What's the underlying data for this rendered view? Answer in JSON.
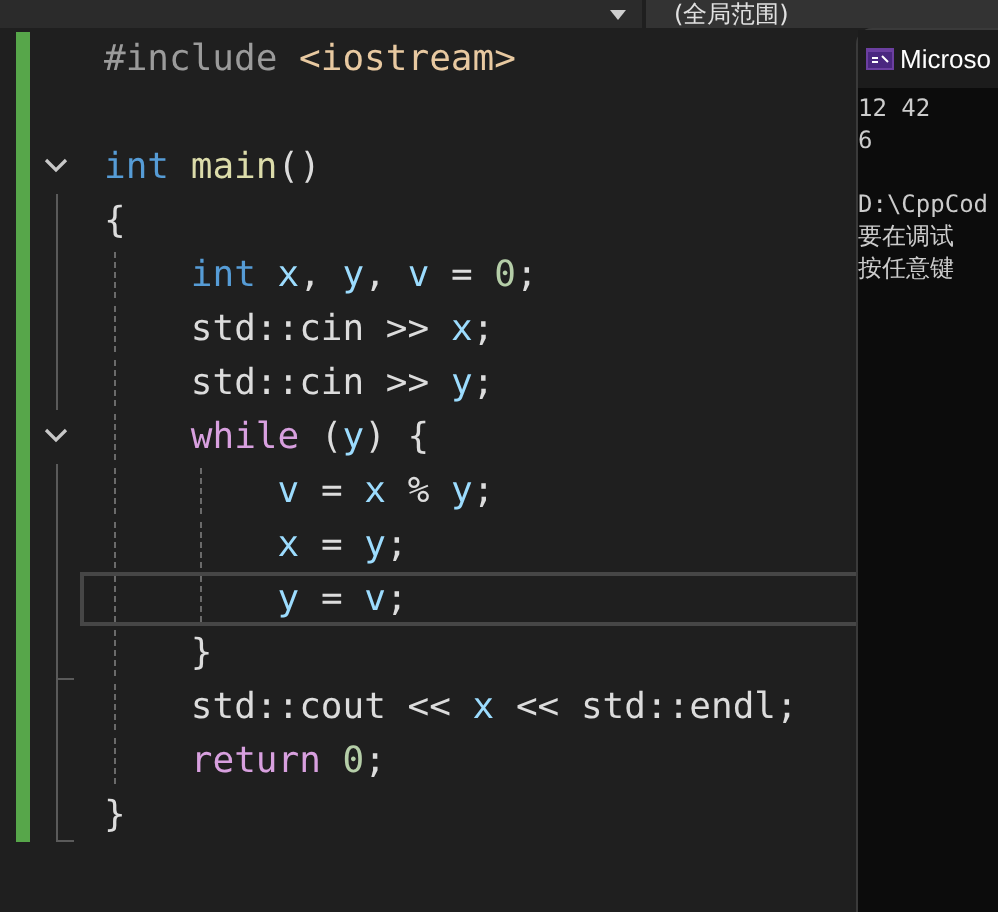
{
  "toolbar": {
    "scope": "(全局范围)"
  },
  "editor": {
    "change_bar": true,
    "lines": [
      {
        "kind": "plain",
        "tokens": [
          {
            "text": "#include ",
            "kind": "preprocessor"
          },
          {
            "text": "<iostream>",
            "kind": "string"
          }
        ]
      },
      {
        "kind": "blank"
      },
      {
        "kind": "open",
        "expanded": true,
        "tokens": [
          {
            "text": "int ",
            "kind": "keyword"
          },
          {
            "text": "main",
            "kind": "function"
          },
          {
            "text": "()",
            "kind": "punct"
          }
        ]
      },
      {
        "kind": "line",
        "tokens": [
          {
            "text": "{",
            "kind": "punct"
          }
        ],
        "children": [
          {
            "kind": "line",
            "tokens": [
              {
                "text": "int ",
                "kind": "keyword"
              },
              {
                "text": "x",
                "kind": "variable"
              },
              {
                "text": ", ",
                "kind": "punct"
              },
              {
                "text": "y",
                "kind": "variable"
              },
              {
                "text": ", ",
                "kind": "punct"
              },
              {
                "text": "v",
                "kind": "variable"
              },
              {
                "text": " = ",
                "kind": "punct"
              },
              {
                "text": "0",
                "kind": "number"
              },
              {
                "text": ";",
                "kind": "punct"
              }
            ]
          },
          {
            "kind": "line",
            "tokens": [
              {
                "text": "std::cin >> ",
                "kind": "punct"
              },
              {
                "text": "x",
                "kind": "variable"
              },
              {
                "text": ";",
                "kind": "punct"
              }
            ]
          },
          {
            "kind": "line",
            "tokens": [
              {
                "text": "std::cin >> ",
                "kind": "punct"
              },
              {
                "text": "y",
                "kind": "variable"
              },
              {
                "text": ";",
                "kind": "punct"
              }
            ]
          },
          {
            "kind": "open",
            "expanded": true,
            "tokens": [
              {
                "text": "while ",
                "kind": "control"
              },
              {
                "text": "(",
                "kind": "punct"
              },
              {
                "text": "y",
                "kind": "variable"
              },
              {
                "text": ") {",
                "kind": "punct"
              }
            ],
            "children": [
              {
                "kind": "line",
                "tokens": [
                  {
                    "text": "v",
                    "kind": "variable"
                  },
                  {
                    "text": " = ",
                    "kind": "punct"
                  },
                  {
                    "text": "x",
                    "kind": "variable"
                  },
                  {
                    "text": " % ",
                    "kind": "punct"
                  },
                  {
                    "text": "y",
                    "kind": "variable"
                  },
                  {
                    "text": ";",
                    "kind": "punct"
                  }
                ]
              },
              {
                "kind": "line",
                "tokens": [
                  {
                    "text": "x",
                    "kind": "variable"
                  },
                  {
                    "text": " = ",
                    "kind": "punct"
                  },
                  {
                    "text": "y",
                    "kind": "variable"
                  },
                  {
                    "text": ";",
                    "kind": "punct"
                  }
                ]
              },
              {
                "kind": "line",
                "current": true,
                "tokens": [
                  {
                    "text": "y",
                    "kind": "variable"
                  },
                  {
                    "text": " = ",
                    "kind": "punct"
                  },
                  {
                    "text": "v",
                    "kind": "variable"
                  },
                  {
                    "text": ";",
                    "kind": "punct"
                  }
                ]
              }
            ]
          },
          {
            "kind": "end",
            "tokens": [
              {
                "text": "}",
                "kind": "punct"
              }
            ]
          },
          {
            "kind": "line",
            "tokens": [
              {
                "text": "std::cout << ",
                "kind": "punct"
              },
              {
                "text": "x",
                "kind": "variable"
              },
              {
                "text": " << std::endl;",
                "kind": "punct"
              }
            ]
          },
          {
            "kind": "line",
            "tokens": [
              {
                "text": "return ",
                "kind": "control"
              },
              {
                "text": "0",
                "kind": "number"
              },
              {
                "text": ";",
                "kind": "punct"
              }
            ]
          }
        ]
      },
      {
        "kind": "end",
        "tokens": [
          {
            "text": "}",
            "kind": "punct"
          }
        ]
      }
    ]
  },
  "console": {
    "title": "Microso",
    "output_groups": [
      {
        "lines": [
          "12 42",
          "6"
        ]
      },
      {
        "lines": [
          "D:\\CppCod",
          "要在调试",
          "按任意键"
        ]
      }
    ]
  }
}
